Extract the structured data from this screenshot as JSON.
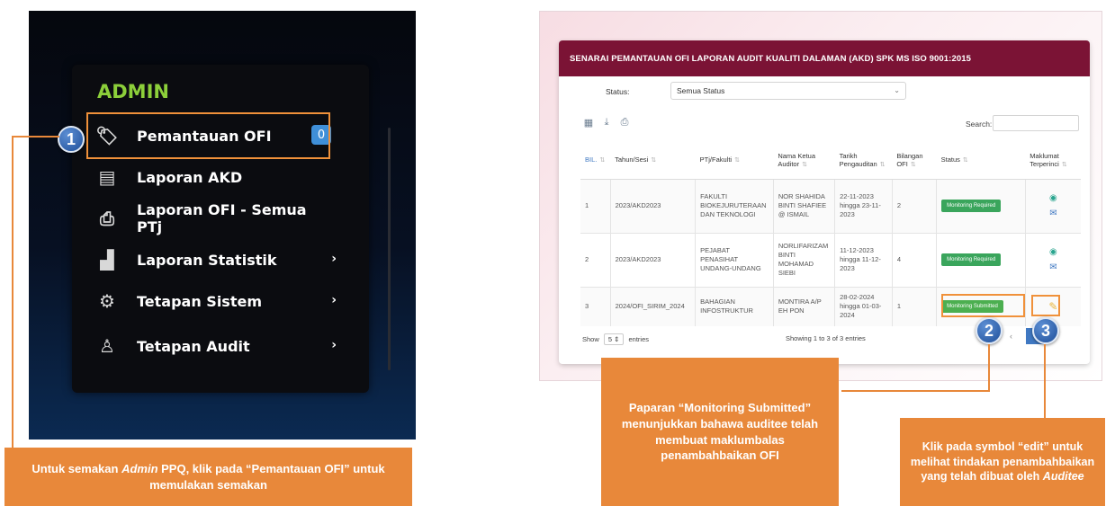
{
  "left": {
    "title": "ADMIN",
    "menu": [
      {
        "label": "Pemantauan OFI",
        "icon": "tags-icon",
        "badge": "0",
        "chevron": ""
      },
      {
        "label": "Laporan AKD",
        "icon": "document-icon",
        "badge": "",
        "chevron": ""
      },
      {
        "label": "Laporan OFI - Semua PTj",
        "icon": "pdf-file-icon",
        "badge": "",
        "chevron": ""
      },
      {
        "label": "Laporan Statistik",
        "icon": "chart-icon",
        "badge": "",
        "chevron": "›"
      },
      {
        "label": "Tetapan Sistem",
        "icon": "gear-icon",
        "badge": "",
        "chevron": "›"
      },
      {
        "label": "Tetapan Audit",
        "icon": "audit-settings-icon",
        "badge": "",
        "chevron": "›"
      }
    ],
    "step_number": "1",
    "callout_pre": "Untuk semakan ",
    "callout_admin": "Admin",
    "callout_post": " PPQ, klik pada “Pemantauan OFI” untuk memulakan semakan"
  },
  "right": {
    "header_title": "SENARAI PEMANTAUAN OFI LAPORAN AUDIT KUALITI DALAMAN (AKD) SPK MS ISO 9001:2015",
    "status_label": "Status:",
    "status_value": "Semua Status",
    "search_label": "Search:",
    "columns": [
      "BIL.",
      "Tahun/Sesi",
      "PTj/Fakulti",
      "Nama Ketua Auditor",
      "Tarikh Pengauditan",
      "Bilangan OFI",
      "Status",
      "Maklumat Terperinci"
    ],
    "rows": [
      {
        "bil": "1",
        "sesi": "2023/AKD2023",
        "ptj": "FAKULTI BIOKEJURUTERAAN DAN TEKNOLOGI",
        "auditor": "NOR SHAHIDA BINTI SHAFIEE @ ISMAIL",
        "tarikh": "22-11-2023 hingga 23-11-2023",
        "ofi": "2",
        "status": "Monitoring Required"
      },
      {
        "bil": "2",
        "sesi": "2023/AKD2023",
        "ptj": "PEJABAT PENASIHAT UNDANG-UNDANG",
        "auditor": "NORLIFARIZAM BINTI MOHAMAD SIEBI",
        "tarikh": "11-12-2023 hingga 11-12-2023",
        "ofi": "4",
        "status": "Monitoring Required"
      },
      {
        "bil": "3",
        "sesi": "2024/OFI_SIRIM_2024",
        "ptj": "BAHAGIAN INFOSTRUKTUR",
        "auditor": "MONTIRA A/P EH PON",
        "tarikh": "28-02-2024 hingga 01-03-2024",
        "ofi": "1",
        "status": "Monitoring Submitted"
      }
    ],
    "show_label": "Show",
    "show_value": "5",
    "entries_label": "entries",
    "info_text": "Showing 1 to 3 of 3 entries",
    "pager_prev": "‹",
    "pager_next": "›",
    "step2": "2",
    "step3": "3",
    "callout2": "Paparan “Monitoring Submitted” menunjukkan bahawa auditee telah membuat maklumbalas penambahbaikan OFI",
    "callout3_pre": "Klik pada symbol “edit” untuk melihat tindakan penambahbaikan yang telah dibuat oleh ",
    "callout3_em": "Auditee"
  },
  "colors": {
    "accent_orange": "#e8883a",
    "header_maroon": "#7b1335",
    "admin_green": "#8ccf3a",
    "badge_blue": "#3f8fd8",
    "status_green": "#4caf50"
  }
}
